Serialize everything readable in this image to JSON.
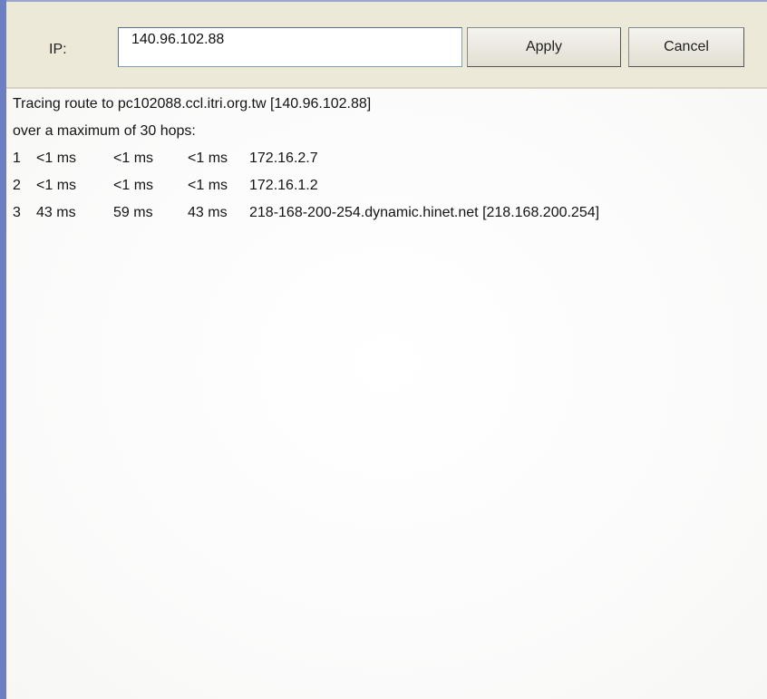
{
  "toolbar": {
    "ip_label": "IP:",
    "ip_value": "140.96.102.88",
    "apply_label": "Apply",
    "cancel_label": "Cancel"
  },
  "output": {
    "header_lines": [
      "Tracing route to pc102088.ccl.itri.org.tw [140.96.102.88]",
      "over a maximum of 30 hops:"
    ],
    "hops": [
      {
        "num": "1",
        "t1": "<1 ms",
        "t2": "<1 ms",
        "t3": "<1 ms",
        "host": "172.16.2.7"
      },
      {
        "num": "2",
        "t1": "<1 ms",
        "t2": "<1 ms",
        "t3": "<1 ms",
        "host": "172.16.1.2"
      },
      {
        "num": "3",
        "t1": "43 ms",
        "t2": "59 ms",
        "t3": "43 ms",
        "host": "218-168-200-254.dynamic.hinet.net [218.168.200.254]"
      }
    ]
  },
  "colors": {
    "toolbar_bg": "#ece9d8",
    "window_border": "#6d7fc4",
    "output_bg": "#ffffff"
  }
}
